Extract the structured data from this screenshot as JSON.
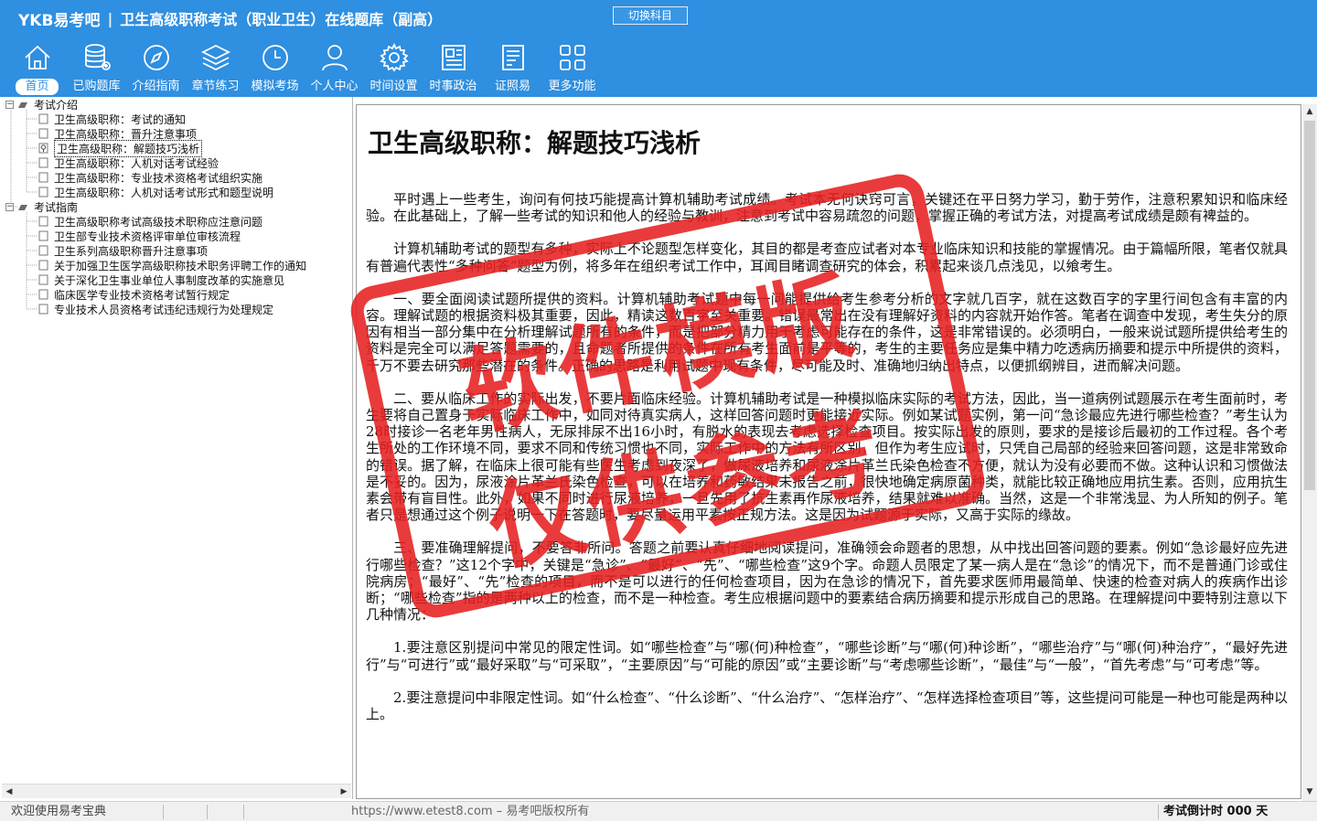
{
  "header": {
    "logo": "YKB易考吧",
    "app_title": "卫生高级职称考试（职业卫生）在线题库（副高）",
    "switch_label": "切换科目"
  },
  "nav": [
    {
      "label": "首页",
      "icon": "home-icon"
    },
    {
      "label": "已购题库",
      "icon": "database-icon"
    },
    {
      "label": "介绍指南",
      "icon": "compass-icon"
    },
    {
      "label": "章节练习",
      "icon": "layers-icon"
    },
    {
      "label": "模拟考场",
      "icon": "clock-icon"
    },
    {
      "label": "个人中心",
      "icon": "user-icon"
    },
    {
      "label": "时间设置",
      "icon": "gear-icon"
    },
    {
      "label": "时事政治",
      "icon": "news-icon"
    },
    {
      "label": "证照易",
      "icon": "document-icon"
    },
    {
      "label": "更多功能",
      "icon": "grid-icon"
    }
  ],
  "tree": {
    "groups": [
      {
        "label": "考试介绍",
        "items": [
          "卫生高级职称：考试的通知",
          "卫生高级职称：晋升注意事项",
          "卫生高级职称：解题技巧浅析",
          "卫生高级职称：人机对话考试经验",
          "卫生高级职称：专业技术资格考试组织实施",
          "卫生高级职称：人机对话考试形式和题型说明"
        ]
      },
      {
        "label": "考试指南",
        "items": [
          "卫生高级职称考试高级技术职称应注意问题",
          "卫生部专业技术资格评审单位审核流程",
          "卫生系列高级职称晋升注意事项",
          "关于加强卫生医学高级职称技术职务评聘工作的通知",
          "关于深化卫生事业单位人事制度改革的实施意见",
          "临床医学专业技术资格考试暂行规定",
          "专业技术人员资格考试违纪违规行为处理规定"
        ]
      }
    ],
    "selected": "卫生高级职称：解题技巧浅析"
  },
  "article": {
    "title": "卫生高级职称：解题技巧浅析",
    "paragraphs": [
      "平时遇上一些考生，询问有何技巧能提高计算机辅助考试成绩。考试本无何诀窍可言，关键还在平日努力学习，勤于劳作，注意积累知识和临床经验。在此基础上，了解一些考试的知识和他人的经验与教训，注意到考试中容易疏忽的问题，掌握正确的考试方法，对提高考试成绩是颇有裨益的。",
      "计算机辅助考试的题型有多种，实际上不论题型怎样变化，其目的都是考查应试者对本专业临床知识和技能的掌握情况。由于篇幅所限，笔者仅就具有普遍代表性“多种问答”题型为例，将多年在组织考试工作中，耳闻目睹调查研究的体会，积累起来谈几点浅见，以飨考生。",
      "一、要全面阅读试题所提供的资料。计算机辅助考试题中每一问能提供给考生参考分析的文字就几百字，就在这数百字的字里行间包含有丰富的内容。理解试题的根据资料极其重要，因此，精读这数百字至关重要。错误最常出在没有理解好资料的内容就开始作答。笔者在调查中发现，考生失分的原因有相当一部分集中在分析理解试题所有的条件，而是把部分精力用于考虑可能存在的条件，这是非常错误的。必须明白，一般来说试题所提供给考生的资料是完全可以满足答题需要的，且命题者所提供的条件在所有考生面前是平等的，考生的主要任务应是集中精力吃透病历摘要和提示中所提供的资料，千万不要去研究那些潜在的条件。正确的思路是利用试题中现有条件，尽可能及时、准确地归纳出特点，以便抓纲辨目，进而解决问题。",
      "二、要从临床工作的实际出发，不要片面临床经验。计算机辅助考试是一种模拟临床实际的考试方法，因此，当一道病例试题展示在考生面前时，考生要将自己置身于实际临床工作中，如同对待真实病人，这样回答问题时更能接近实际。例如某试题实例，第一问“急诊最应先进行哪些检查？”考生认为28时接诊一名老年男性病人，无尿排尿不出16小时，有脱水的表现去考虑选择检查项目。按实际出发的原则，要求的是接诊后最初的工作过程。各个考生所处的工作环境不同，要求不同和传统习惯也不同，实际工作中的方法有所区别，但作为考生应试时，只凭自己局部的经验来回答问题，这是非常致命的错误。据了解，在临床上很可能有些医生考虑到夜深了，做尿液培养和尿液涂片革兰氏染色检查不方便，就认为没有必要而不做。这种认识和习惯做法是不妥的。因为，尿液涂片革兰氏染色检查，可以在培养和药敏结果未报告之前，很快地确定病原菌种类，就能比较正确地应用抗生素。否则，应用抗生素会带有盲目性。此外，如果不同时进行尿液培养，一旦先用了抗生素再作尿液培养，结果就难以准确。当然，这是一个非常浅显、为人所知的例子。笔者只是想通过这个例子说明一下在答题时，要尽量运用平素按正规方法。这是因为试题源于实际，又高于实际的缘故。",
      "三、要准确理解提问，不要答非所问。答题之前要认真仔细地阅读提问，准确领会命题者的思想，从中找出回答问题的要素。例如“急诊最好应先进行哪些检查？”这12个字中，关键是“急诊”、“最好”、“先”、“哪些检查”这9个字。命题人员限定了某一病人是在“急诊”的情况下，而不是普通门诊或住院病房；“最好”、“先”检查的项目，而不是可以进行的任何检查项目，因为在急诊的情况下，首先要求医师用最简单、快速的检查对病人的疾病作出诊断；“哪些检查”指的是两种以上的检查，而不是一种检查。考生应根据问题中的要素结合病历摘要和提示形成自己的思路。在理解提问中要特别注意以下几种情况：",
      "1.要注意区别提问中常见的限定性词。如“哪些检查”与“哪(何)种检查”，“哪些诊断”与“哪(何)种诊断”，“哪些治疗”与“哪(何)种治疗”，“最好先进行”与“可进行”或“最好采取”与“可采取”，“主要原因”与“可能的原因”或“主要诊断”与“考虑哪些诊断”，“最佳”与“一般”，“首先考虑”与“可考虑”等。",
      "2.要注意提问中非限定性词。如“什么检查”、“什么诊断”、“什么治疗”、“怎样治疗”、“怎样选择检查项目”等，这些提问可能是一种也可能是两种以上。"
    ]
  },
  "watermark": {
    "line1": "软件模版",
    "line2": "仅供参考"
  },
  "status": {
    "welcome": "欢迎使用易考宝典",
    "website": "https://www.etest8.com – 易考吧版权所有",
    "countdown": "考试倒计时 000 天"
  },
  "colors": {
    "header_bg": "#2f8fe0",
    "watermark": "#e62020"
  }
}
